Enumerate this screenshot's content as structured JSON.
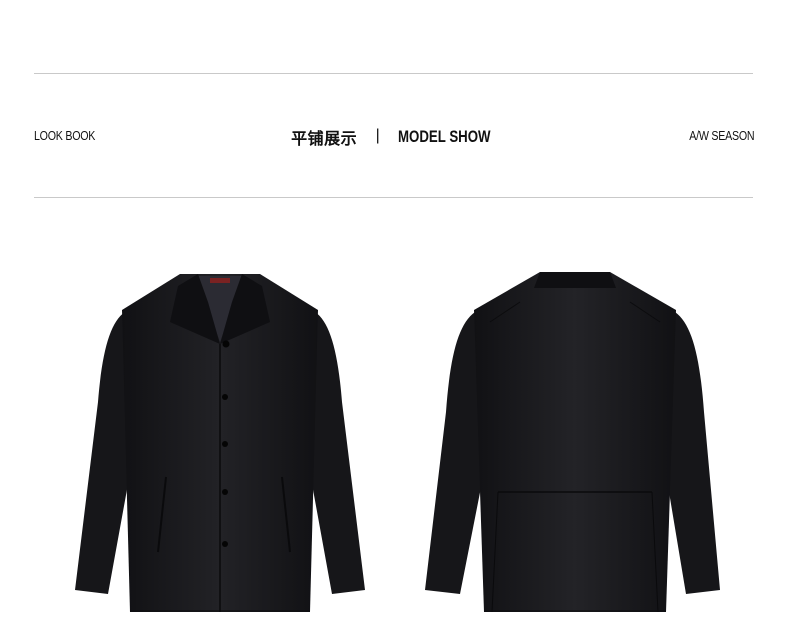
{
  "header": {
    "left_label": "LOOK BOOK",
    "center_cn": "平铺展示",
    "center_separator": "|",
    "center_en": "MODEL SHOW",
    "right_label": "A/W SEASON"
  },
  "products": [
    {
      "view": "front",
      "icon": "jacket-front-image"
    },
    {
      "view": "back",
      "icon": "jacket-back-image"
    }
  ],
  "colors": {
    "garment": "#1b1b1e",
    "rule": "#c9c9c9",
    "text": "#111111"
  }
}
